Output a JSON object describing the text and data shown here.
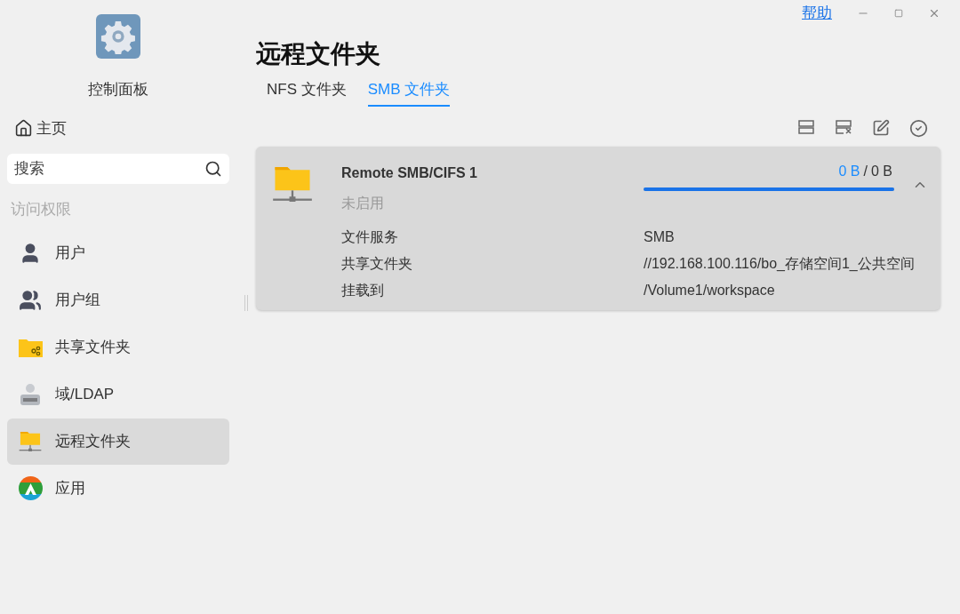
{
  "window": {
    "help_link": "帮助"
  },
  "sidebar": {
    "app_title": "控制面板",
    "home": "主页",
    "search": {
      "placeholder": "搜索"
    },
    "section": "访问权限",
    "items": [
      {
        "kind": "user",
        "label": "用户",
        "selected": false
      },
      {
        "kind": "group",
        "label": "用户组",
        "selected": false
      },
      {
        "kind": "shared-folder",
        "label": "共享文件夹",
        "selected": false
      },
      {
        "kind": "ldap",
        "label": "域/LDAP",
        "selected": false
      },
      {
        "kind": "remote-folder",
        "label": "远程文件夹",
        "selected": true
      },
      {
        "kind": "app",
        "label": "应用",
        "selected": false
      }
    ]
  },
  "page": {
    "title": "远程文件夹",
    "tabs": [
      {
        "label": "NFS 文件夹",
        "selected": false
      },
      {
        "label": "SMB 文件夹",
        "selected": true
      }
    ],
    "mounts": [
      {
        "name": "Remote SMB/CIFS 1",
        "status": "未启用",
        "used": "0 B",
        "separator": "/",
        "total": "0 B",
        "level": 1,
        "expanded": true,
        "details": [
          {
            "label": "文件服务",
            "value": "SMB"
          },
          {
            "label": "共享文件夹",
            "value": "//192.168.100.116/bo_存储空间1_公共空间"
          },
          {
            "label": "挂载到",
            "value": "/Volume1/workspace"
          }
        ]
      }
    ]
  }
}
